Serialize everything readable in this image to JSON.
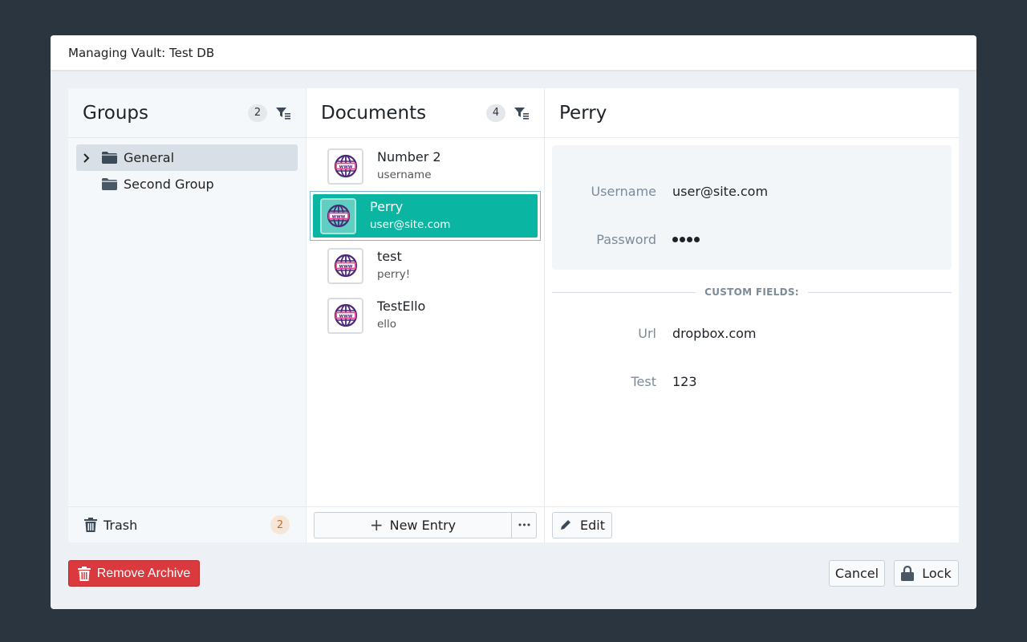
{
  "window": {
    "title": "Managing Vault: Test DB"
  },
  "groups": {
    "title": "Groups",
    "count": "2",
    "items": [
      {
        "label": "General",
        "expandable": true,
        "active": true
      },
      {
        "label": "Second Group",
        "expandable": false,
        "active": false
      }
    ],
    "trash": {
      "label": "Trash",
      "count": "2"
    }
  },
  "documents": {
    "title": "Documents",
    "count": "4",
    "items": [
      {
        "title": "Number 2",
        "subtitle": "username",
        "icon": "www-globe-icon",
        "active": false
      },
      {
        "title": "Perry",
        "subtitle": "user@site.com",
        "icon": "www-globe-icon",
        "active": true
      },
      {
        "title": "test",
        "subtitle": "perry!",
        "icon": "www-globe-icon",
        "active": false
      },
      {
        "title": "TestEllo",
        "subtitle": "ello",
        "icon": "www-globe-icon",
        "active": false
      }
    ],
    "new_entry_label": "New Entry",
    "more_label": "•••"
  },
  "detail": {
    "title": "Perry",
    "fields": [
      {
        "label": "Username",
        "value": "user@site.com"
      },
      {
        "label": "Password",
        "value": "••••",
        "masked": true
      }
    ],
    "custom_fields_heading": "CUSTOM FIELDS:",
    "custom_fields": [
      {
        "label": "Url",
        "value": "dropbox.com"
      },
      {
        "label": "Test",
        "value": "123"
      }
    ],
    "edit_label": "Edit"
  },
  "footer": {
    "remove_label": "Remove Archive",
    "cancel_label": "Cancel",
    "lock_label": "Lock"
  },
  "colors": {
    "accent": "#0ab5a1",
    "danger": "#da3a3d",
    "background": "#2a3540"
  }
}
